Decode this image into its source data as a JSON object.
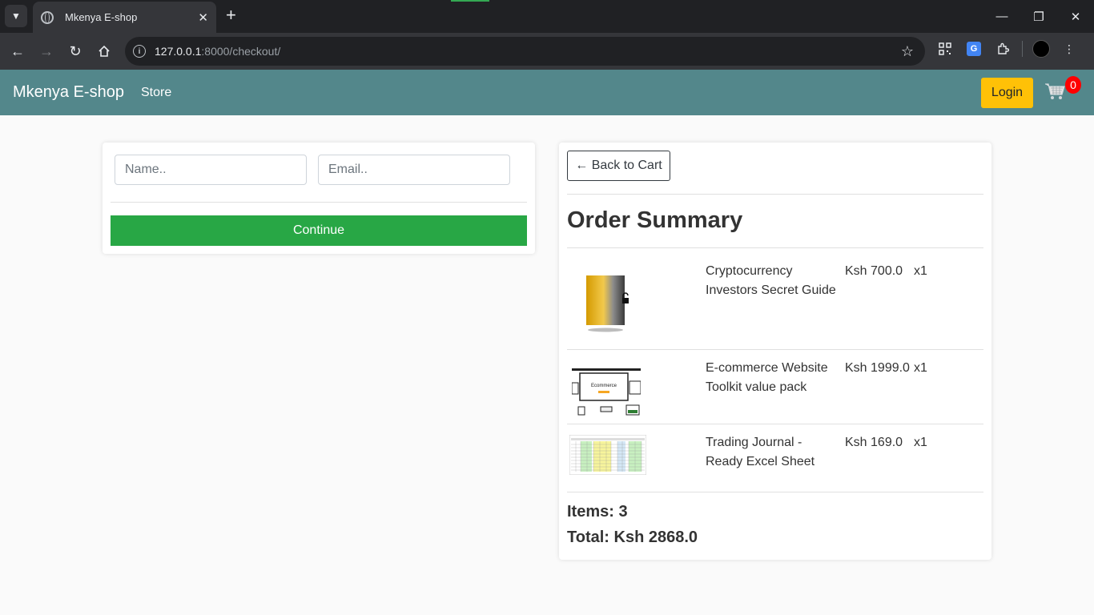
{
  "browser": {
    "tab_title": "Mkenya E-shop",
    "url_host": "127.0.0.1",
    "url_rest": ":8000/checkout/"
  },
  "navbar": {
    "brand": "Mkenya E-shop",
    "store_link": "Store",
    "login_label": "Login",
    "cart_count": "0",
    "colors": {
      "navbar_bg": "#53878b",
      "login_bg": "#ffc107",
      "badge_bg": "#ff0000"
    }
  },
  "form": {
    "name_placeholder": "Name..",
    "email_placeholder": "Email..",
    "continue_label": "Continue",
    "continue_color": "#28a745"
  },
  "summary": {
    "back_label": "← Back to Cart",
    "title": "Order Summary",
    "items": [
      {
        "name": "Cryptocurrency Investors Secret Guide",
        "price": "Ksh 700.0",
        "qty": "x1",
        "thumb_icon": "crypto-guide-book-image"
      },
      {
        "name": "E-commerce Website Toolkit value pack",
        "price": "Ksh 1999.0",
        "qty": "x1",
        "thumb_icon": "ecommerce-toolkit-image"
      },
      {
        "name": "Trading Journal - Ready Excel Sheet",
        "price": "Ksh 169.0",
        "qty": "x1",
        "thumb_icon": "trading-journal-sheet-image"
      }
    ],
    "items_text": "Items: 3",
    "total_text": "Total: Ksh 2868.0"
  }
}
